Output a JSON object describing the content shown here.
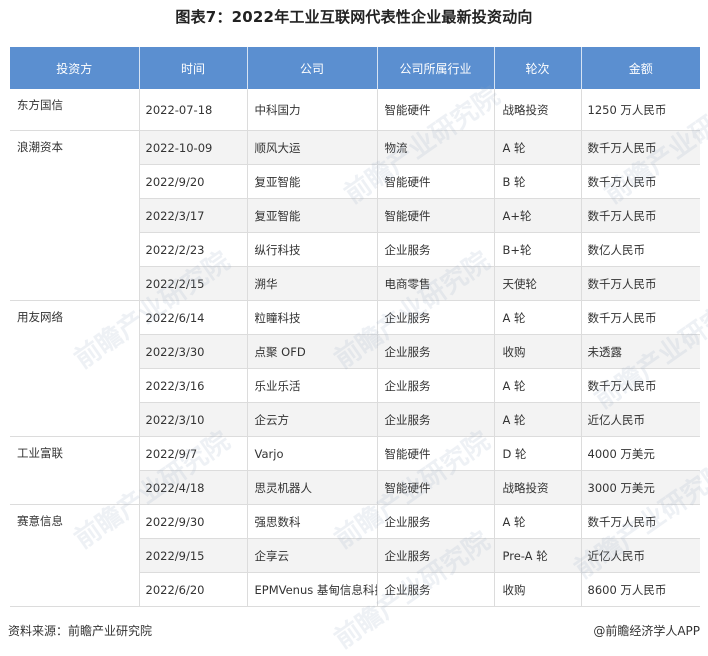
{
  "title": "图表7：2022年工业互联网代表性企业最新投资动向",
  "table": {
    "headers": [
      "投资方",
      "时间",
      "公司",
      "公司所属行业",
      "轮次",
      "金额"
    ],
    "groups": [
      {
        "investor": "东方国信",
        "rows": [
          {
            "date": "2022-07-18",
            "company": "中科国力",
            "industry": "智能硬件",
            "round": "战略投资",
            "amount": "1250 万人民币"
          }
        ]
      },
      {
        "investor": "浪潮资本",
        "rows": [
          {
            "date": "2022-10-09",
            "company": "顺风大运",
            "industry": "物流",
            "round": "A 轮",
            "amount": "数千万人民币"
          },
          {
            "date": "2022/9/20",
            "company": "复亚智能",
            "industry": "智能硬件",
            "round": "B 轮",
            "amount": "数千万人民币"
          },
          {
            "date": "2022/3/17",
            "company": "复亚智能",
            "industry": "智能硬件",
            "round": "A+轮",
            "amount": "数千万人民币"
          },
          {
            "date": "2022/2/23",
            "company": "纵行科技",
            "industry": "企业服务",
            "round": "B+轮",
            "amount": "数亿人民币"
          },
          {
            "date": "2022/2/15",
            "company": "溯华",
            "industry": "电商零售",
            "round": "天使轮",
            "amount": "数千万人民币"
          }
        ]
      },
      {
        "investor": "用友网络",
        "rows": [
          {
            "date": "2022/6/14",
            "company": "粒瞳科技",
            "industry": "企业服务",
            "round": "A 轮",
            "amount": "数千万人民币"
          },
          {
            "date": "2022/3/30",
            "company": "点聚 OFD",
            "industry": "企业服务",
            "round": "收购",
            "amount": "未透露"
          },
          {
            "date": "2022/3/16",
            "company": "乐业乐活",
            "industry": "企业服务",
            "round": "A 轮",
            "amount": "数千万人民币"
          },
          {
            "date": "2022/3/10",
            "company": "企云方",
            "industry": "企业服务",
            "round": "A 轮",
            "amount": "近亿人民币"
          }
        ]
      },
      {
        "investor": "工业富联",
        "rows": [
          {
            "date": "2022/9/7",
            "company": "Varjo",
            "industry": "智能硬件",
            "round": "D 轮",
            "amount": "4000 万美元"
          },
          {
            "date": "2022/4/18",
            "company": "思灵机器人",
            "industry": "智能硬件",
            "round": "战略投资",
            "amount": "3000 万美元"
          }
        ]
      },
      {
        "investor": "赛意信息",
        "rows": [
          {
            "date": "2022/9/30",
            "company": "强思数科",
            "industry": "企业服务",
            "round": "A 轮",
            "amount": "数千万人民币"
          },
          {
            "date": "2022/9/15",
            "company": "企享云",
            "industry": "企业服务",
            "round": "Pre-A 轮",
            "amount": "近亿人民币"
          },
          {
            "date": "2022/6/20",
            "company": "EPMVenus 基甸信息科技",
            "industry": "企业服务",
            "round": "收购",
            "amount": "8600 万人民币"
          }
        ]
      }
    ]
  },
  "footer": {
    "source": "资料来源：前瞻产业研究院",
    "brand": "@前瞻经济学人APP"
  },
  "watermark_text": "前瞻产业研究院",
  "colors": {
    "header_bg": "#5b8fd0",
    "header_text": "#ffffff",
    "alt_row_bg": "#f3f3f3"
  }
}
